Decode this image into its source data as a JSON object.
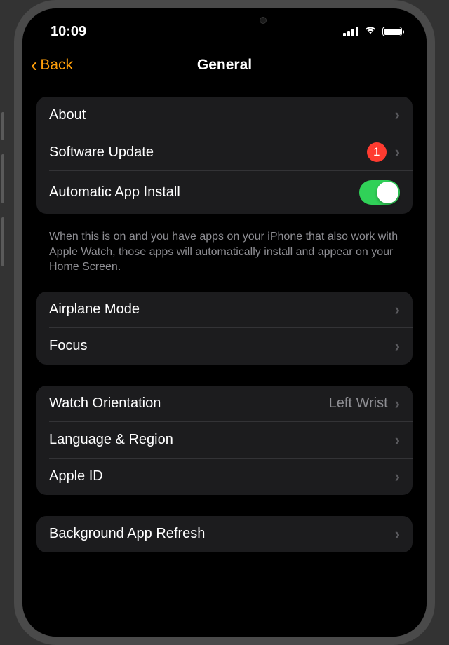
{
  "status_bar": {
    "time": "10:09"
  },
  "nav": {
    "back_label": "Back",
    "title": "General"
  },
  "group1": {
    "about": "About",
    "software_update": "Software Update",
    "software_update_badge": "1",
    "auto_install": "Automatic App Install",
    "auto_install_on": true,
    "footer": "When this is on and you have apps on your iPhone that also work with Apple Watch, those apps will automatically install and appear on your Home Screen."
  },
  "group2": {
    "airplane": "Airplane Mode",
    "focus": "Focus"
  },
  "group3": {
    "orientation": "Watch Orientation",
    "orientation_value": "Left Wrist",
    "language": "Language & Region",
    "apple_id": "Apple ID"
  },
  "group4": {
    "bg_refresh": "Background App Refresh"
  }
}
